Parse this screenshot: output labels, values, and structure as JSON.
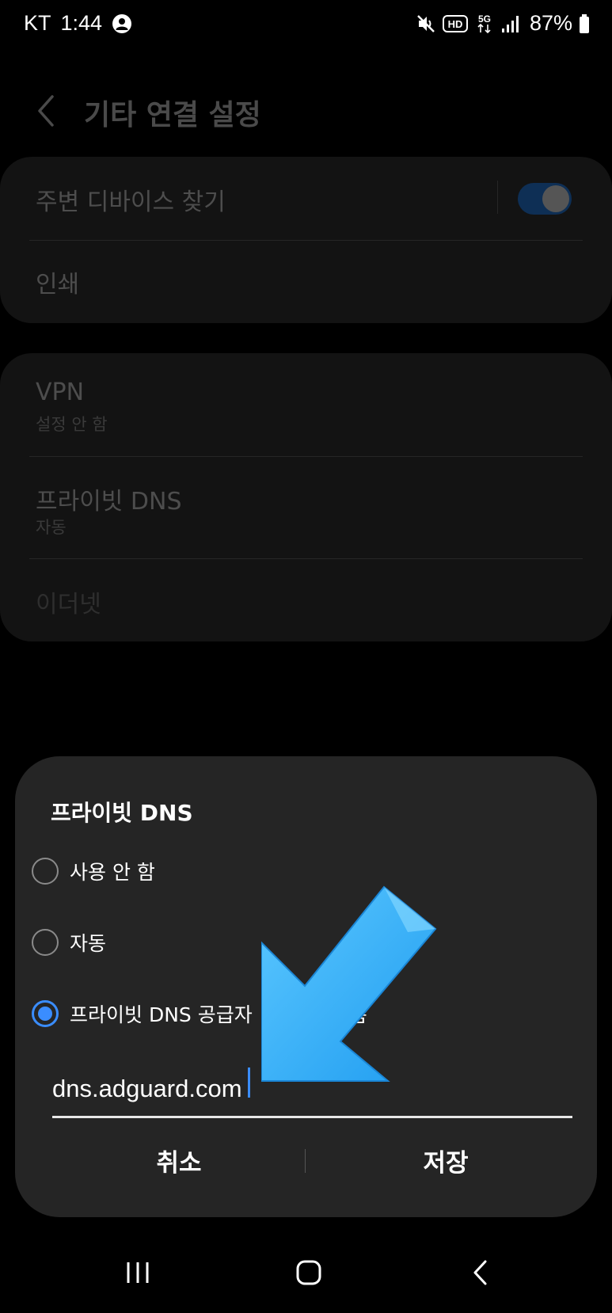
{
  "status_bar": {
    "carrier": "KT",
    "time": "1:44",
    "network_badge": "HD",
    "network_type": "5G",
    "battery_percent": "87%",
    "icons": [
      "account-circle-icon",
      "mute-icon",
      "hd-icon",
      "5g-icon",
      "signal-icon",
      "battery-icon"
    ]
  },
  "header": {
    "title": "기타 연결 설정",
    "back_icon": "chevron-left-icon"
  },
  "card1": {
    "nearby_label": "주변 디바이스 찾기",
    "nearby_enabled": true,
    "print_label": "인쇄"
  },
  "card2": {
    "vpn_label": "VPN",
    "vpn_sub": "설정 안 함",
    "private_dns_label": "프라이빗 DNS",
    "private_dns_sub": "자동",
    "ethernet_label": "이더넷"
  },
  "dialog": {
    "title": "프라이빗 DNS",
    "options": [
      {
        "label": "사용 안 함",
        "selected": false
      },
      {
        "label": "자동",
        "selected": false
      },
      {
        "label": "프라이빗 DNS 공급자",
        "label_tail": "름",
        "selected": true
      }
    ],
    "input_value": "dns.adguard.com",
    "cancel_label": "취소",
    "save_label": "저장"
  },
  "colors": {
    "accent": "#3a8dff",
    "annotation_arrow": "#3ab4ff"
  },
  "nav_bar": {
    "icons": [
      "recents-icon",
      "home-icon",
      "back-icon"
    ]
  }
}
